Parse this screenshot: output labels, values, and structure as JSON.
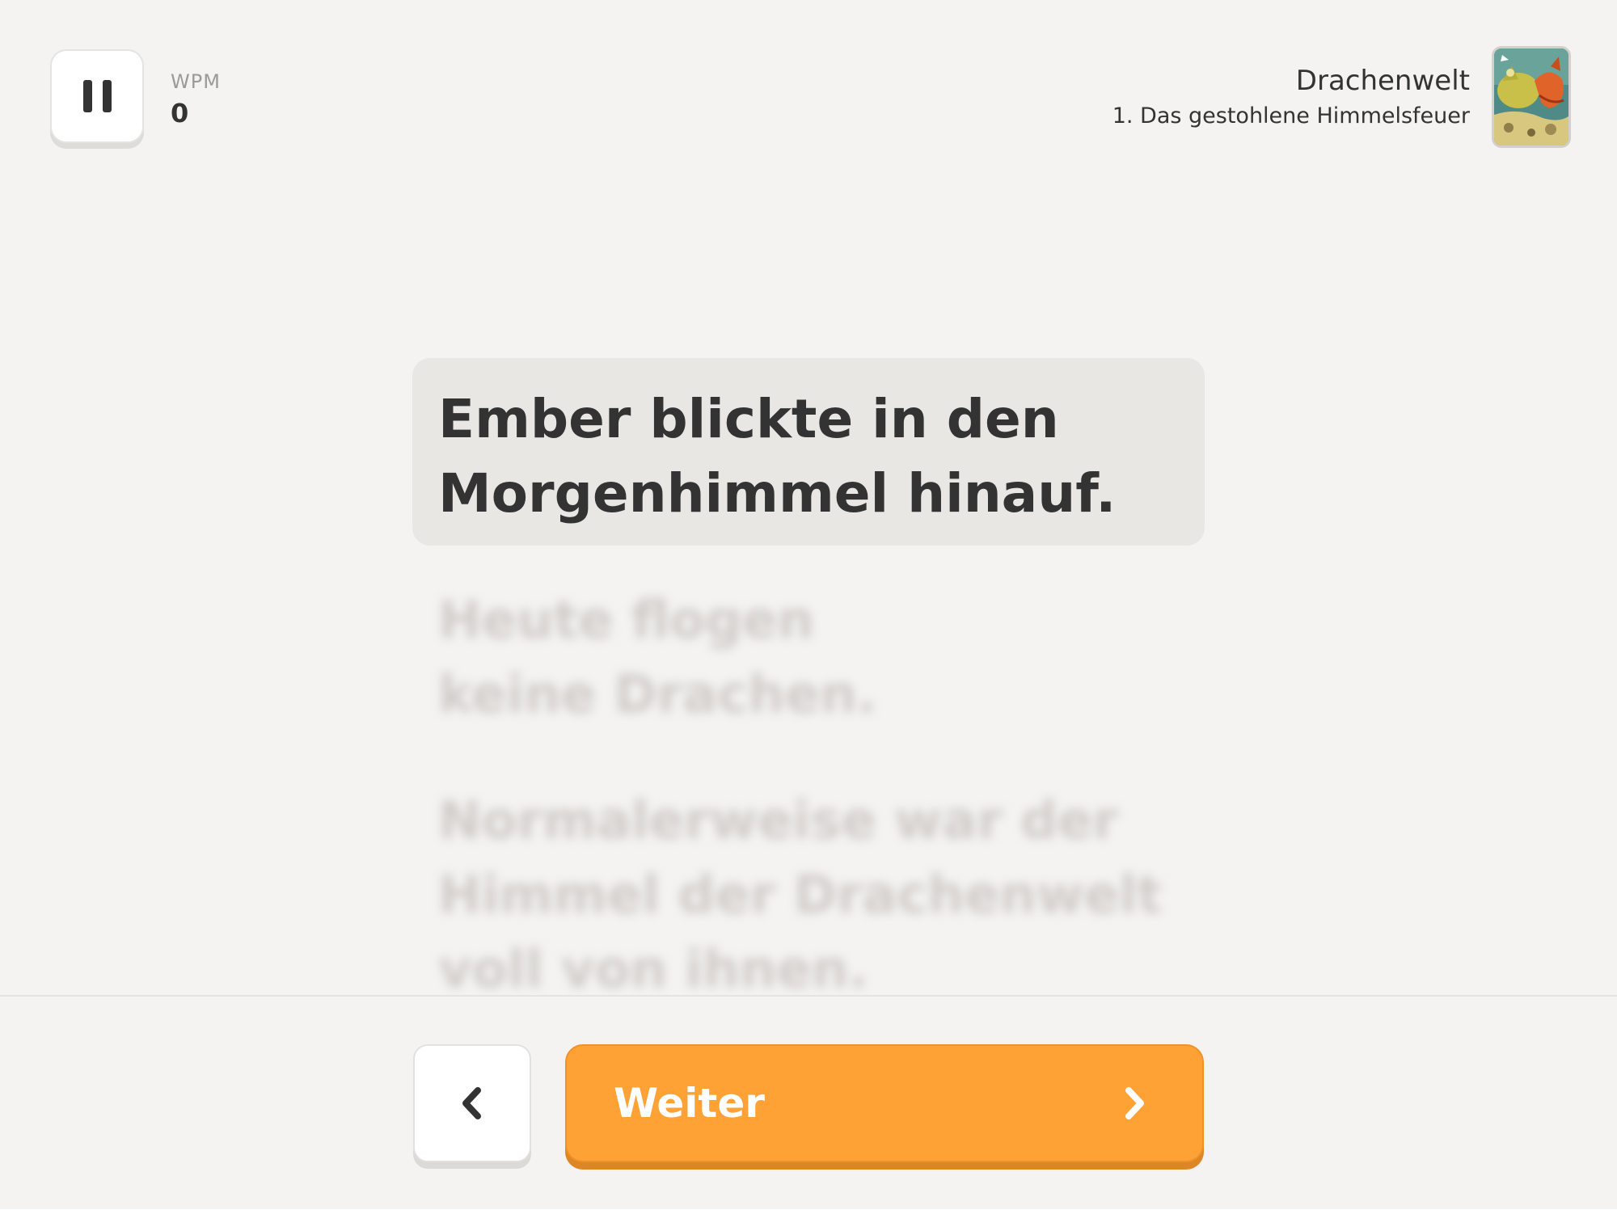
{
  "header": {
    "pause_button_label": "Pause",
    "wpm_label": "WPM",
    "wpm_value": "0",
    "book_title": "Drachenwelt",
    "chapter_title": "1. Das gestohlene Himmelsfeuer",
    "cover_icon": "dragon-book-cover-icon"
  },
  "reader": {
    "current_sentence_line1": "Ember blickte in den",
    "current_sentence_line2": "Morgenhimmel hinauf.",
    "upcoming": [
      {
        "line1": "Heute flogen",
        "line2": "keine Drachen."
      },
      {
        "line1": "Normalerweise war der",
        "line2": "Himmel der Drachenwelt",
        "line3": "voll von ihnen."
      }
    ]
  },
  "footer": {
    "back_icon": "chevron-left-icon",
    "continue_label": "Weiter",
    "continue_icon": "chevron-right-icon"
  },
  "colors": {
    "background": "#f4f3f1",
    "highlight": "#e9e7e4",
    "accent": "#fea236",
    "text": "#333333"
  }
}
